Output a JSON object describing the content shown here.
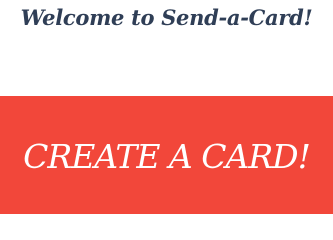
{
  "header": {
    "title": "Welcome to Send-a-Card!"
  },
  "cta": {
    "label": "CREATE A CARD!"
  },
  "colors": {
    "title_text": "#2f3e56",
    "cta_background": "#f2473a",
    "cta_text": "#ffffff",
    "page_background": "#ffffff"
  }
}
